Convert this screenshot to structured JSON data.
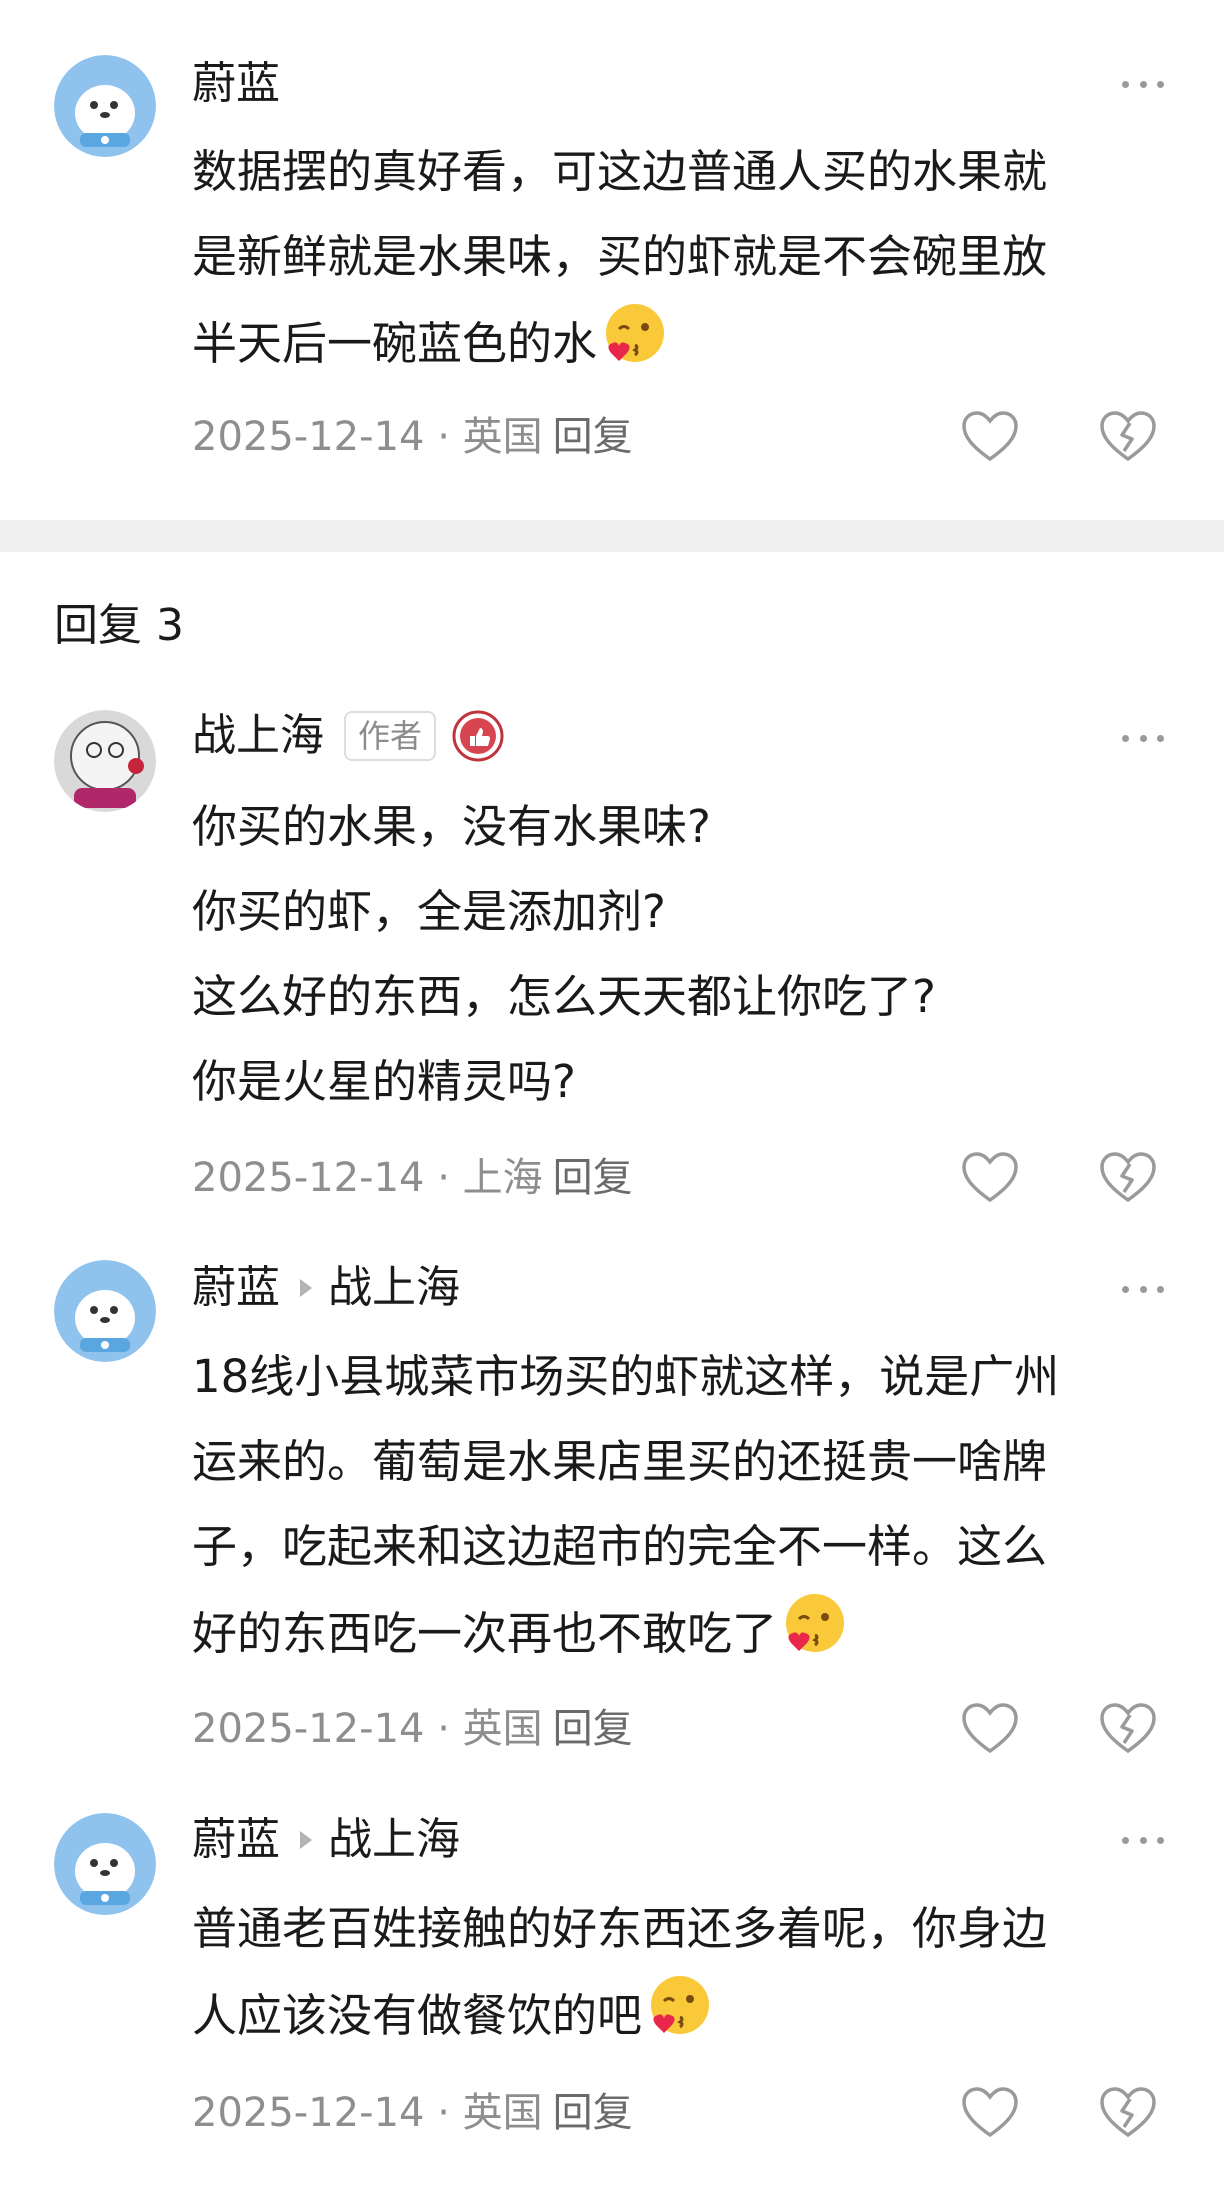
{
  "top_comment": {
    "username": "蔚蓝",
    "text": [
      "数据摆的真好看，可这边普通人买的水果就",
      "是新鲜就是水果味，买的虾就是不会碗里放",
      "半天后一碗蓝色的水"
    ],
    "emoji": "kiss-wink-emoji",
    "date": "2025-12-14",
    "location": "英国",
    "reply_label": "回复"
  },
  "replies_section": {
    "title": "回复 3"
  },
  "replies": [
    {
      "username": "战上海",
      "author_tag": "作者",
      "badge_icon": "thumbs-up-badge-icon",
      "text": [
        "你买的水果，没有水果味?",
        "你买的虾，全是添加剂?",
        "这么好的东西，怎么天天都让你吃了?",
        "你是火星的精灵吗?"
      ],
      "date": "2025-12-14",
      "location": "上海",
      "reply_label": "回复"
    },
    {
      "username": "蔚蓝",
      "reply_to": "战上海",
      "text": [
        "18线小县城菜市场买的虾就这样，说是广州",
        "运来的。葡萄是水果店里买的还挺贵一啥牌",
        "子，吃起来和这边超市的完全不一样。这么",
        "好的东西吃一次再也不敢吃了"
      ],
      "emoji": "kiss-wink-emoji",
      "date": "2025-12-14",
      "location": "英国",
      "reply_label": "回复"
    },
    {
      "username": "蔚蓝",
      "reply_to": "战上海",
      "text": [
        "普通老百姓接触的好东西还多着呢，你身边",
        "人应该没有做餐饮的吧"
      ],
      "emoji": "kiss-wink-emoji",
      "date": "2025-12-14",
      "location": "英国",
      "reply_label": "回复"
    }
  ],
  "meta_separator": "·",
  "colors": {
    "text": "#1a1a1a",
    "meta": "#8e8e8e",
    "divider": "#f0f0f0",
    "avatar_blue": "#8fc3ee"
  }
}
